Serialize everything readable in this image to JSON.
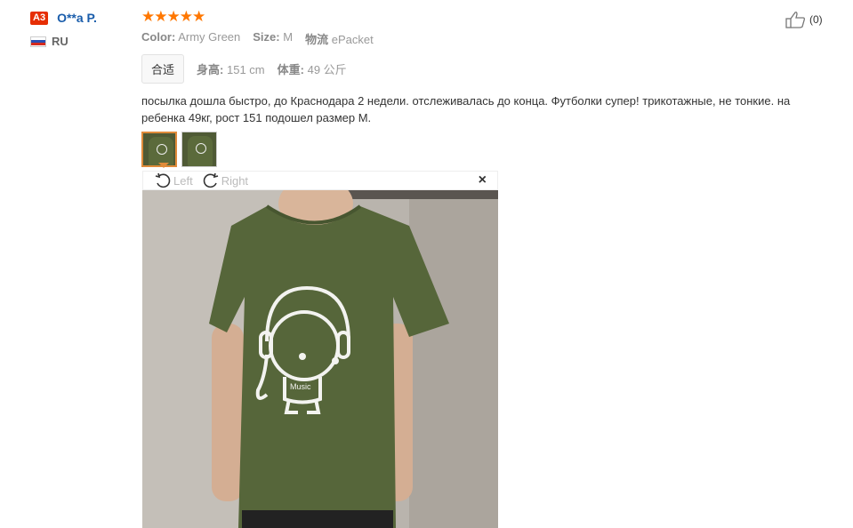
{
  "user": {
    "badge": "A3",
    "name": "O**a P.",
    "country": "RU"
  },
  "review": {
    "stars": "★★★★★",
    "rating": 5,
    "color_label": "Color:",
    "color_value": "Army Green",
    "size_label": "Size:",
    "size_value": "M",
    "shipping_label": "物流",
    "shipping_value": "ePacket",
    "fit_label": "合适",
    "height_label": "身高:",
    "height_value": "151 cm",
    "weight_label": "体重:",
    "weight_value": "49 公斤",
    "text": "посылка дошла быстро, до Краснодара 2 недели. отслеживалась до конца. Футболки супер! трикотажные, не тонкие. на ребенка 49кг, рост 151 подошел размер M.",
    "helpful_count": "(0)"
  },
  "viewer": {
    "left_label": "Left",
    "right_label": "Right",
    "close_label": "×",
    "shirt_print_text": "Music"
  },
  "colors": {
    "accent": "#e62e04",
    "link": "#1a5dab",
    "star": "#ff7700",
    "shirt": "#56663a"
  }
}
